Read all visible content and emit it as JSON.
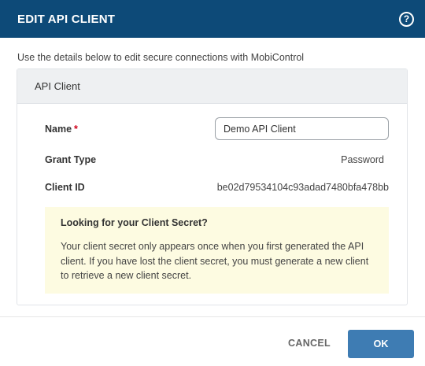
{
  "dialog": {
    "title": "EDIT API CLIENT",
    "help_icon": "question-circle-icon",
    "intro": "Use the details below to edit secure connections with MobiControl"
  },
  "card": {
    "header": "API Client",
    "name": {
      "label": "Name",
      "required_marker": "*",
      "value": "Demo API Client"
    },
    "grant_type": {
      "label": "Grant Type",
      "value": "Password"
    },
    "client_id": {
      "label": "Client ID",
      "value": "be02d79534104c93adad7480bfa478bb"
    },
    "notice": {
      "title": "Looking for your Client Secret?",
      "body": "Your client secret only appears once when you first generated the API client. If you have lost the client secret, you must generate a new client to retrieve a new client secret."
    }
  },
  "footer": {
    "cancel_label": "CANCEL",
    "ok_label": "OK"
  },
  "colors": {
    "header_bg": "#0d4a78",
    "primary_button": "#3e7cb3",
    "notice_bg": "#fdfbe1",
    "required": "#d0021b"
  }
}
